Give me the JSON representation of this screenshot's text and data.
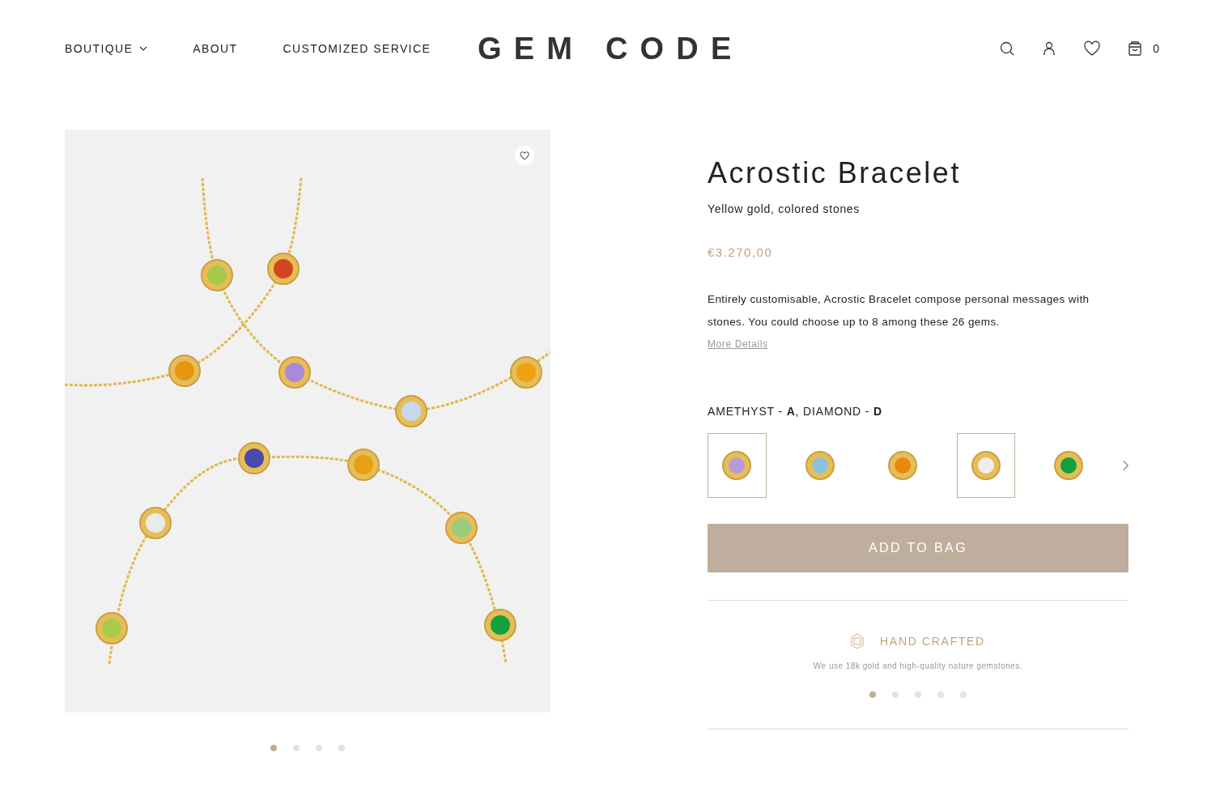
{
  "nav": {
    "items": [
      {
        "label": "BOUTIQUE",
        "dropdown": true
      },
      {
        "label": "ABOUT",
        "dropdown": false
      },
      {
        "label": "CUSTOMIZED SERVICE",
        "dropdown": false
      }
    ],
    "logo": "GEM CODE",
    "cart_count": "0"
  },
  "gallery": {
    "dots": [
      {
        "selected": true
      },
      {
        "selected": false
      },
      {
        "selected": false
      },
      {
        "selected": false
      }
    ]
  },
  "product": {
    "title": "Acrostic Bracelet",
    "subtitle": "Yellow gold, colored stones",
    "price": "€3.270,00",
    "description": "Entirely customisable, Acrostic Bracelet compose personal messages with stones. You could choose up to 8 among these 26 gems.",
    "more_link": "More Details",
    "selection": "AMETHYST - **A**, DIAMOND - **D**",
    "stones": [
      {
        "color": "#b89ad8",
        "selected": true
      },
      {
        "color": "#8cc3dc",
        "selected": false
      },
      {
        "color": "#e8880f",
        "selected": false
      },
      {
        "color": "#eeeeee",
        "selected": true
      },
      {
        "color": "#12a040",
        "selected": false
      }
    ],
    "add_button": "ADD TO BAG"
  },
  "features": {
    "title": "HAND CRAFTED",
    "text": "We use 18k gold and high-quality nature gemstones.",
    "dots": [
      {
        "selected": true
      },
      {
        "selected": false
      },
      {
        "selected": false
      },
      {
        "selected": false
      },
      {
        "selected": false
      }
    ]
  }
}
